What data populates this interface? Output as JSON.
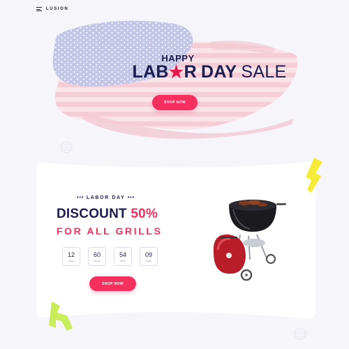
{
  "header": {
    "logo_text": "LUSION"
  },
  "hero": {
    "happy": "HAPPY",
    "title_part1": "LAB",
    "title_star": "★",
    "title_part2": "R",
    "title_part3": "DAY",
    "title_sale": "SALE",
    "button_label": "SHOP NOW"
  },
  "promo": {
    "dots_left": "•••",
    "subtitle": "LABOR DAY",
    "dots_right": "•••",
    "discount_text": "DISCOUNT",
    "discount_pct": "50%",
    "grills": "FOR ALL GRILLS",
    "countdown": [
      {
        "value": "12",
        "label": "Days"
      },
      {
        "value": "60",
        "label": "Hours"
      },
      {
        "value": "54",
        "label": "Mins"
      },
      {
        "value": "09",
        "label": "Secs"
      }
    ],
    "button_label": "SHOP NOW"
  },
  "colors": {
    "navy": "#1c1d4f",
    "accent": "#f5305e",
    "yellow": "#f5ec3a",
    "green": "#c9ec5a"
  }
}
